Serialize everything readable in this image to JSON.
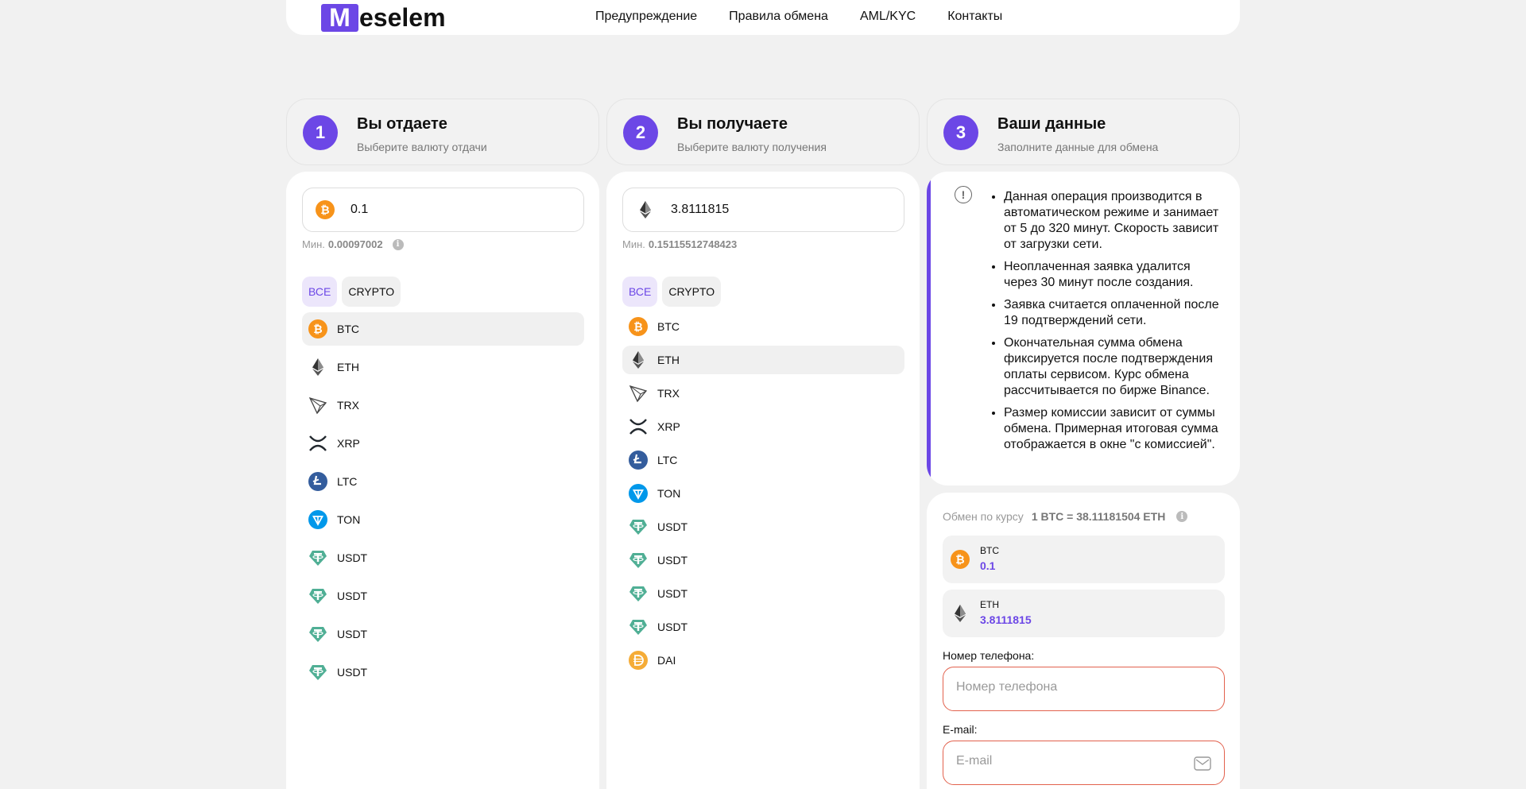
{
  "header": {
    "logo_letter": "M",
    "logo_rest": "eselem",
    "nav": [
      "Предупреждение",
      "Правила обмена",
      "AML/KYC",
      "Контакты"
    ]
  },
  "steps": [
    {
      "num": "1",
      "title": "Вы отдаете",
      "subtitle": "Выберите валюту отдачи"
    },
    {
      "num": "2",
      "title": "Вы получаете",
      "subtitle": "Выберите валюту получения"
    },
    {
      "num": "3",
      "title": "Ваши данные",
      "subtitle": "Заполните данные для обмена"
    }
  ],
  "give": {
    "amount": "0.1",
    "amount_coin": "BTC",
    "min_label": "Мин.",
    "min_value": "0.00097002",
    "filters": [
      "ВСЕ",
      "CRYPTO"
    ],
    "selected": "BTC",
    "coins": [
      "BTC",
      "ETH",
      "TRX",
      "XRP",
      "LTC",
      "TON",
      "USDT",
      "USDT",
      "USDT",
      "USDT"
    ]
  },
  "get": {
    "amount": "3.8111815",
    "amount_coin": "ETH",
    "min_label": "Мин.",
    "min_value": "0.15115512748423",
    "filters": [
      "ВСЕ",
      "CRYPTO"
    ],
    "selected": "ETH",
    "coins": [
      "BTC",
      "ETH",
      "TRX",
      "XRP",
      "LTC",
      "TON",
      "USDT",
      "USDT",
      "USDT",
      "USDT",
      "DAI"
    ]
  },
  "notice": {
    "items": [
      "Данная операция производится в автоматическом режиме и занимает от 5 до 320 минут. Скорость зависит от загрузки сети.",
      "Неоплаченная заявка удалится через 30 минут после создания.",
      "Заявка считается оплаченной после 19 подтверждений сети.",
      "Окончательная сумма обмена фиксируется после подтверждения оплаты сервисом. Курс обмена рассчитывается по бирже Binance.",
      "Размер комиссии зависит от суммы обмена. Примерная итоговая сумма отображается в окне \"с комиссией\"."
    ]
  },
  "summary": {
    "rate_label": "Обмен по курсу",
    "rate_value": "1 BTC = 38.11181504 ETH",
    "give_currency": "BTC",
    "give_amount": "0.1",
    "get_currency": "ETH",
    "get_amount": "3.8111815",
    "phone_label": "Номер телефона:",
    "phone_placeholder": "Номер телефона",
    "email_label": "E-mail:",
    "email_placeholder": "E-mail"
  },
  "colors": {
    "accent": "#6c47e6",
    "error_border": "#e2614d",
    "btc": "#f7931a",
    "usdt": "#50af95",
    "ltc": "#345d9d",
    "ton": "#0098ea",
    "dai": "#f5ac37"
  }
}
